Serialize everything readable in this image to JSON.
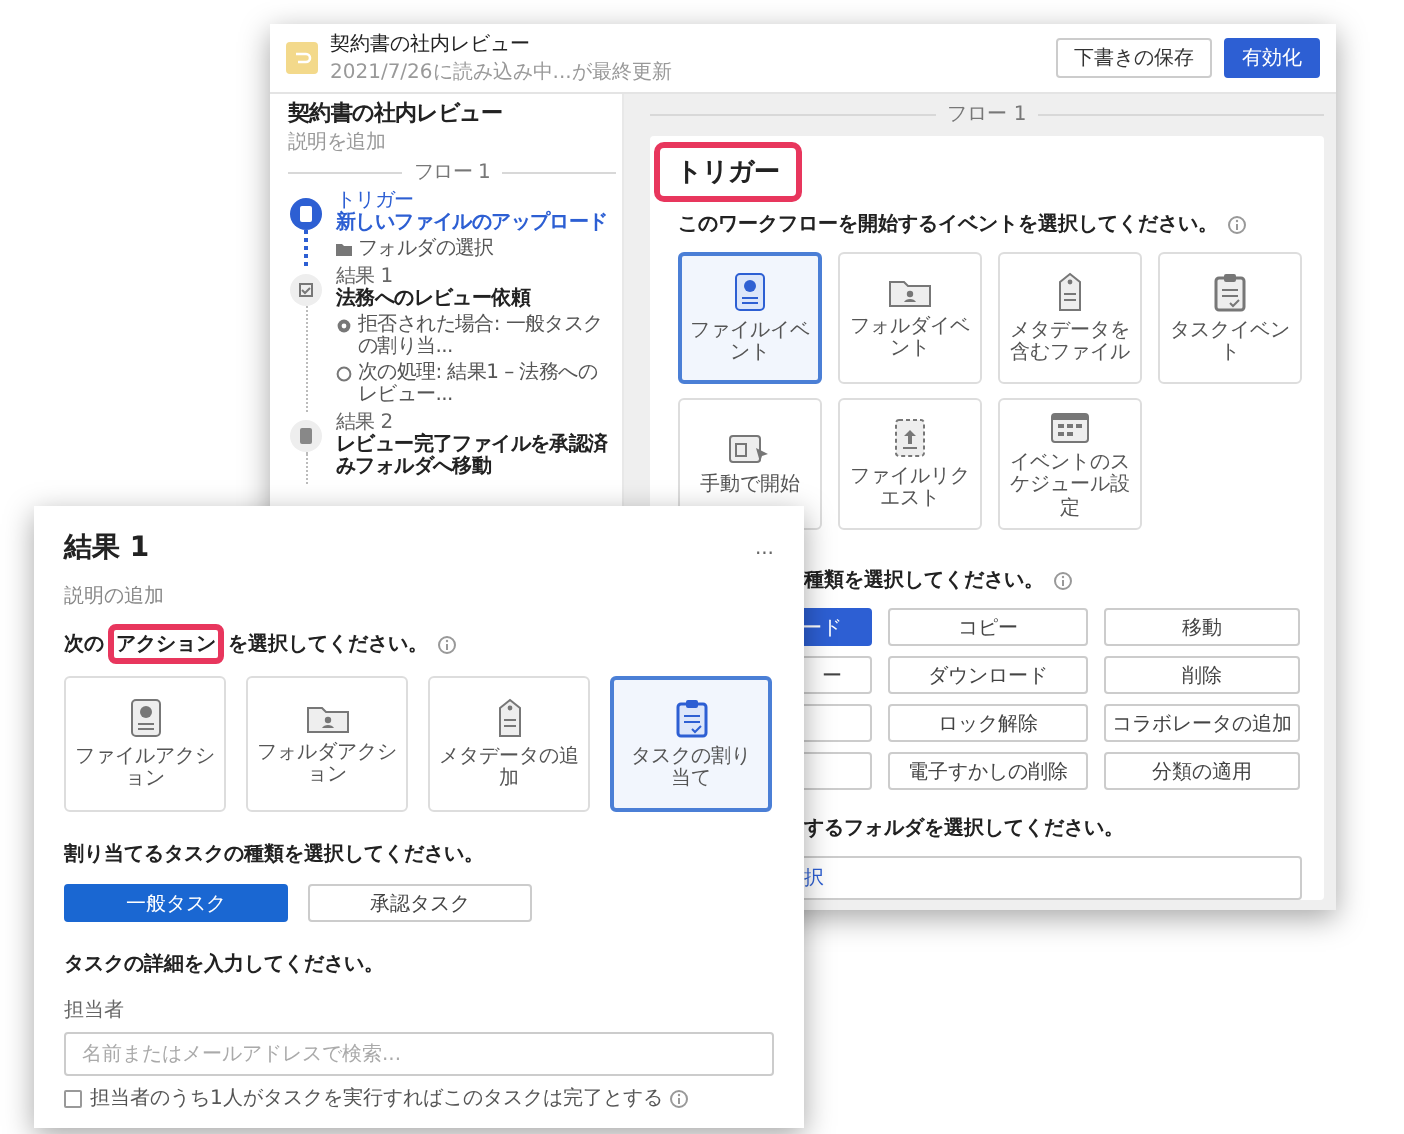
{
  "back_window": {
    "header": {
      "title": "契約書の社内レビュー",
      "subtitle": "2021/7/26に読み込み中...が最終更新",
      "buttons": [
        {
          "label": "下書きの保存",
          "kind": "secondary"
        },
        {
          "label": "有効化",
          "kind": "primary"
        }
      ]
    },
    "sidebar": {
      "title": "契約書の社内レビュー",
      "description": "説明を追加",
      "flow_label": "フロー 1",
      "steps": [
        {
          "kind": "trigger",
          "label": "トリガー",
          "title": "新しいファイルのアップロード",
          "selected": true,
          "details": [
            {
              "kind": "folder",
              "text": "フォルダの選択"
            }
          ]
        },
        {
          "kind": "task",
          "label": "結果 1",
          "title": "法務へのレビュー依頼",
          "selected": false,
          "details": [
            {
              "kind": "rejected",
              "text": "拒否された場合: 一般タスクの割り当..."
            },
            {
              "kind": "next",
              "text": "次の処理: 結果1 – 法務へのレビュー..."
            }
          ]
        },
        {
          "kind": "file",
          "label": "結果 2",
          "title": "レビュー完了ファイルを承認済みフォルダへ移動",
          "selected": false
        }
      ]
    },
    "main": {
      "flow_label": "フロー 1",
      "heading": "トリガー",
      "heading_highlighted": true,
      "prompt": "このワークフローを開始するイベントを選択してください。",
      "events": [
        {
          "kind": "file",
          "label": "ファイルイベント",
          "selected": true
        },
        {
          "kind": "folder",
          "label": "フォルダイベント",
          "selected": false
        },
        {
          "kind": "metadata",
          "label": "メタデータを含むファイル",
          "selected": false
        },
        {
          "kind": "task",
          "label": "タスクイベント",
          "selected": false
        },
        {
          "kind": "manual",
          "label": "手動で開始",
          "selected": false
        },
        {
          "kind": "request",
          "label": "ファイルリクエスト",
          "selected": false
        },
        {
          "kind": "schedule",
          "label": "イベントのスケジュール設定",
          "selected": false
        }
      ],
      "action_prompt": "種類を選択してください。",
      "actions": [
        {
          "label": "ード",
          "selected": true
        },
        {
          "label": "コピー",
          "selected": false
        },
        {
          "label": "移動",
          "selected": false
        },
        {
          "label": "ー",
          "selected": false
        },
        {
          "label": "ダウンロード",
          "selected": false
        },
        {
          "label": "削除",
          "selected": false
        },
        {
          "selected": false
        },
        {
          "label": "ロック解除",
          "selected": false
        },
        {
          "label": "コラボレータの追加",
          "selected": false
        },
        {
          "selected": false
        },
        {
          "label": "電子すかしの削除",
          "selected": false
        },
        {
          "label": "分類の適用",
          "selected": false
        }
      ],
      "folder_prompt": "するフォルダを選択してください。",
      "folder_field": {
        "value": "択"
      }
    }
  },
  "front_window": {
    "title": "結果 1",
    "menu": "...",
    "description": "説明の追加",
    "prompt": [
      {
        "text": "次の",
        "highlighted": false
      },
      {
        "text": "アクション",
        "highlighted": true
      },
      {
        "text": "を選択してください。",
        "highlighted": false
      }
    ],
    "actions": [
      {
        "kind": "file",
        "label": "ファイルアクション",
        "selected": false
      },
      {
        "kind": "folder",
        "label": "フォルダアクション",
        "selected": false
      },
      {
        "kind": "metadata",
        "label": "メタデータの追加",
        "selected": false
      },
      {
        "kind": "task",
        "label": "タスクの割り当て",
        "selected": true
      }
    ],
    "task_type_prompt": "割り当てるタスクの種類を選択してください。",
    "task_types": [
      {
        "label": "一般タスク",
        "selected": true
      },
      {
        "label": "承認タスク",
        "selected": false
      }
    ],
    "details_prompt": "タスクの詳細を入力してください。",
    "assignee": {
      "label": "担当者",
      "placeholder": "名前またはメールアドレスで検索..."
    },
    "completion_option": {
      "label": "担当者のうち1人がタスクを実行すればこのタスクは完了とする",
      "checked": false
    }
  }
}
